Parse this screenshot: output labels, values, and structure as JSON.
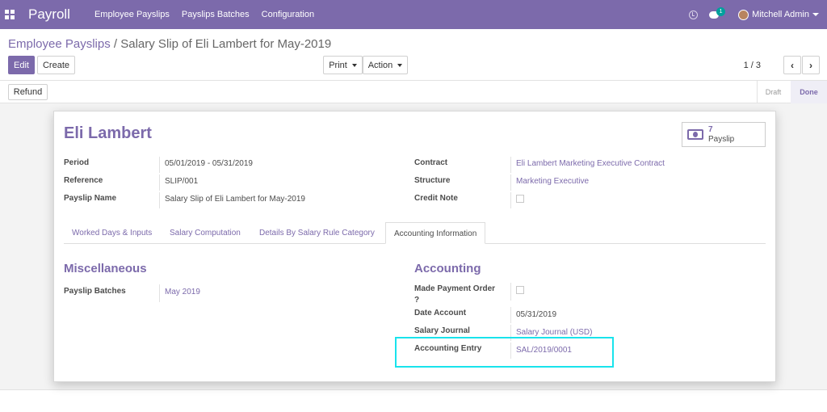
{
  "navbar": {
    "brand": "Payroll",
    "menus": [
      "Employee Payslips",
      "Payslips Batches",
      "Configuration"
    ],
    "chat_count": "1",
    "user": "Mitchell Admin"
  },
  "control": {
    "breadcrumb_parent": "Employee Payslips",
    "breadcrumb_sep": "/",
    "breadcrumb_current": "Salary Slip of Eli Lambert for May-2019",
    "edit_label": "Edit",
    "create_label": "Create",
    "print_label": "Print",
    "action_label": "Action",
    "pager": "1 / 3",
    "prev_label": "‹",
    "next_label": "›"
  },
  "statusbar": {
    "refund_label": "Refund",
    "stages": [
      "Draft",
      "Done"
    ]
  },
  "sheet": {
    "employee_name": "Eli Lambert",
    "payslip_stat": {
      "count": "7",
      "label": "Payslip"
    },
    "left_fields": [
      {
        "label": "Period",
        "value": "05/01/2019 - 05/31/2019"
      },
      {
        "label": "Reference",
        "value": "SLIP/001"
      },
      {
        "label": "Payslip Name",
        "value": "Salary Slip of Eli Lambert for May-2019"
      }
    ],
    "right_fields": [
      {
        "label": "Contract",
        "value": "Eli Lambert Marketing Executive Contract"
      },
      {
        "label": "Structure",
        "value": "Marketing Executive"
      },
      {
        "label": "Credit Note",
        "value": ""
      }
    ],
    "tabs": [
      "Worked Days & Inputs",
      "Salary Computation",
      "Details By Salary Rule Category",
      "Accounting Information"
    ],
    "misc": {
      "title": "Miscellaneous",
      "batch_label": "Payslip Batches",
      "batch_value": "May 2019"
    },
    "accounting": {
      "title": "Accounting",
      "made_payment_label": "Made Payment Order",
      "made_payment_label2": "?",
      "date_account_label": "Date Account",
      "date_account_value": "05/31/2019",
      "journal_label": "Salary Journal",
      "journal_value": "Salary Journal (USD)",
      "entry_label": "Accounting Entry",
      "entry_value": "SAL/2019/0001"
    }
  },
  "colors": {
    "brand": "#7c6aab",
    "highlight": "#19e3ec"
  }
}
